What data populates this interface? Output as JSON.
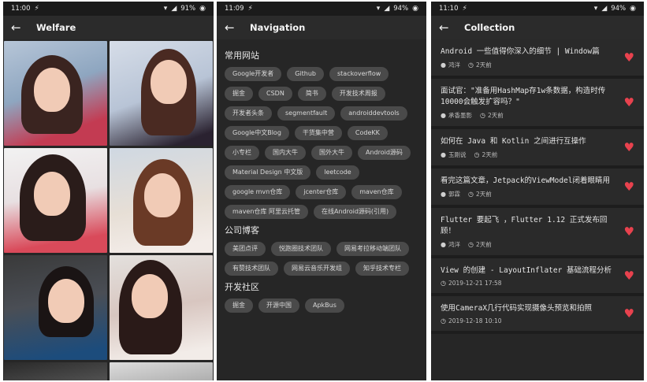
{
  "screens": [
    {
      "status": {
        "time": "11:00",
        "battery": "91%"
      },
      "title": "Welfare"
    },
    {
      "status": {
        "time": "11:09",
        "battery": "94%"
      },
      "title": "Navigation",
      "sections": [
        {
          "title": "常用网站",
          "chips": [
            "Google开发者",
            "Github",
            "stackoverflow",
            "掘金",
            "CSDN",
            "简书",
            "开发技术周报",
            "开发者头条",
            "segmentfault",
            "androiddevtools",
            "Google中文Blog",
            "干货集中营",
            "CodeKK",
            "小专栏",
            "国内大牛",
            "国外大牛",
            "Android源码",
            "Material Design 中文版",
            "leetcode",
            "google mvn仓库",
            "jcenter仓库",
            "maven仓库",
            "maven仓库 阿里云托管",
            "在线Android源码(引用)"
          ]
        },
        {
          "title": "公司博客",
          "chips": [
            "美团点评",
            "悦跑圈技术团队",
            "网易考拉移动端团队",
            "有赞技术团队",
            "网易云音乐开发组",
            "知乎技术专栏"
          ]
        },
        {
          "title": "开发社区",
          "chips": [
            "掘金",
            "开源中国",
            "ApkBus"
          ]
        }
      ]
    },
    {
      "status": {
        "time": "11:10",
        "battery": "94%"
      },
      "title": "Collection",
      "items": [
        {
          "title": "Android 一些值得你深入的细节 | Window篇",
          "author": "鸿洋",
          "time": "2天前"
        },
        {
          "title": "面试官：\"准备用HashMap存1w条数据，构造时传10000会触发扩容吗？\"",
          "author": "承香墨影",
          "time": "2天前"
        },
        {
          "title": "如何在 Java 和 Kotlin 之间进行互操作",
          "author": "玉刚说",
          "time": "2天前"
        },
        {
          "title": "看完这篇文章，Jetpack的ViewModel闭着眼睛用",
          "author": "郭霖",
          "time": "2天前"
        },
        {
          "title": "Flutter 要起飞 ，Flutter 1.12 正式发布回顾！",
          "author": "鸿洋",
          "time": "2天前"
        },
        {
          "title": "View 的创建 - LayoutInflater 基础流程分析",
          "author": "",
          "time": "2019-12-21 17:58"
        },
        {
          "title": "使用CameraX几行代码实现摄像头预览和拍照",
          "author": "",
          "time": "2019-12-18 10:10"
        }
      ]
    }
  ],
  "colors": {
    "background": "#262626",
    "appbar": "#2b2b2b",
    "chip": "#4a4a4a",
    "heart": "#e8424e"
  },
  "icons": [
    "back-arrow-icon",
    "wifi-icon",
    "signal-icon",
    "battery-icon",
    "person-icon",
    "clock-icon",
    "heart-icon"
  ]
}
